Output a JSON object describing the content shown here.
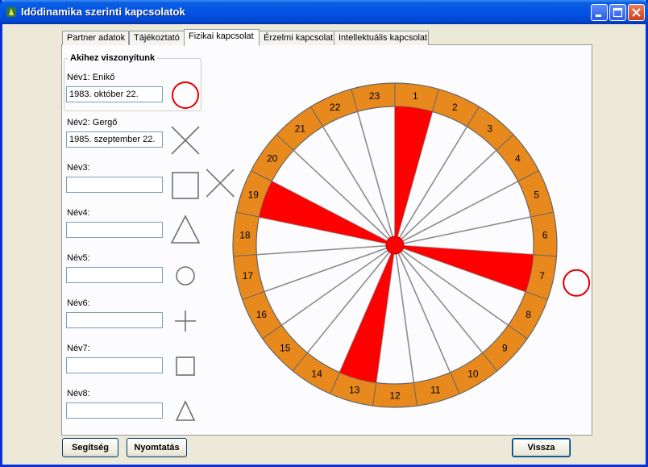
{
  "window": {
    "title": "Idődinamika szerinti kapcsolatok"
  },
  "tabs": [
    {
      "label": "Partner adatok",
      "active": false
    },
    {
      "label": "Tájékoztató",
      "active": false
    },
    {
      "label": "Fizikai kapcsolat",
      "active": true
    },
    {
      "label": "Érzelmi kapcsolat",
      "active": false
    },
    {
      "label": "Intellektuális kapcsolat",
      "active": false
    }
  ],
  "reference_group": {
    "title": "Akihez viszonyítunk"
  },
  "persons": [
    {
      "label": "Név1: Enikő",
      "value": "1983. október 22.",
      "symbol": "circle",
      "color": "#e00000"
    },
    {
      "label": "Név2: Gergő",
      "value": "1985. szeptember 22.",
      "symbol": "x",
      "color": "#707070"
    },
    {
      "label": "Név3:",
      "value": "",
      "symbol": "square",
      "color": "#707070"
    },
    {
      "label": "Név4:",
      "value": "",
      "symbol": "triangle",
      "color": "#707070"
    },
    {
      "label": "Név5:",
      "value": "",
      "symbol": "small-circle",
      "color": "#707070"
    },
    {
      "label": "Név6:",
      "value": "",
      "symbol": "plus",
      "color": "#707070"
    },
    {
      "label": "Név7:",
      "value": "",
      "symbol": "small-square",
      "color": "#707070"
    },
    {
      "label": "Név8:",
      "value": "",
      "symbol": "small-triangle",
      "color": "#707070"
    }
  ],
  "dial": {
    "segments": [
      "1",
      "2",
      "3",
      "4",
      "5",
      "6",
      "7",
      "8",
      "9",
      "10",
      "11",
      "12",
      "13",
      "14",
      "15",
      "16",
      "17",
      "18",
      "19",
      "20",
      "21",
      "22",
      "23"
    ],
    "ring_color": "#e8891e",
    "wedge_color": "#ff0000",
    "highlight_wedges": [
      1,
      7,
      13,
      19
    ],
    "markers": [
      {
        "person": "Név1: Enikő",
        "symbol": "circle",
        "segment": 7
      },
      {
        "person": "Név2: Gergő",
        "symbol": "x",
        "segment": 19
      }
    ]
  },
  "buttons": {
    "help": "Segítség",
    "print": "Nyomtatás",
    "back": "Vissza"
  }
}
